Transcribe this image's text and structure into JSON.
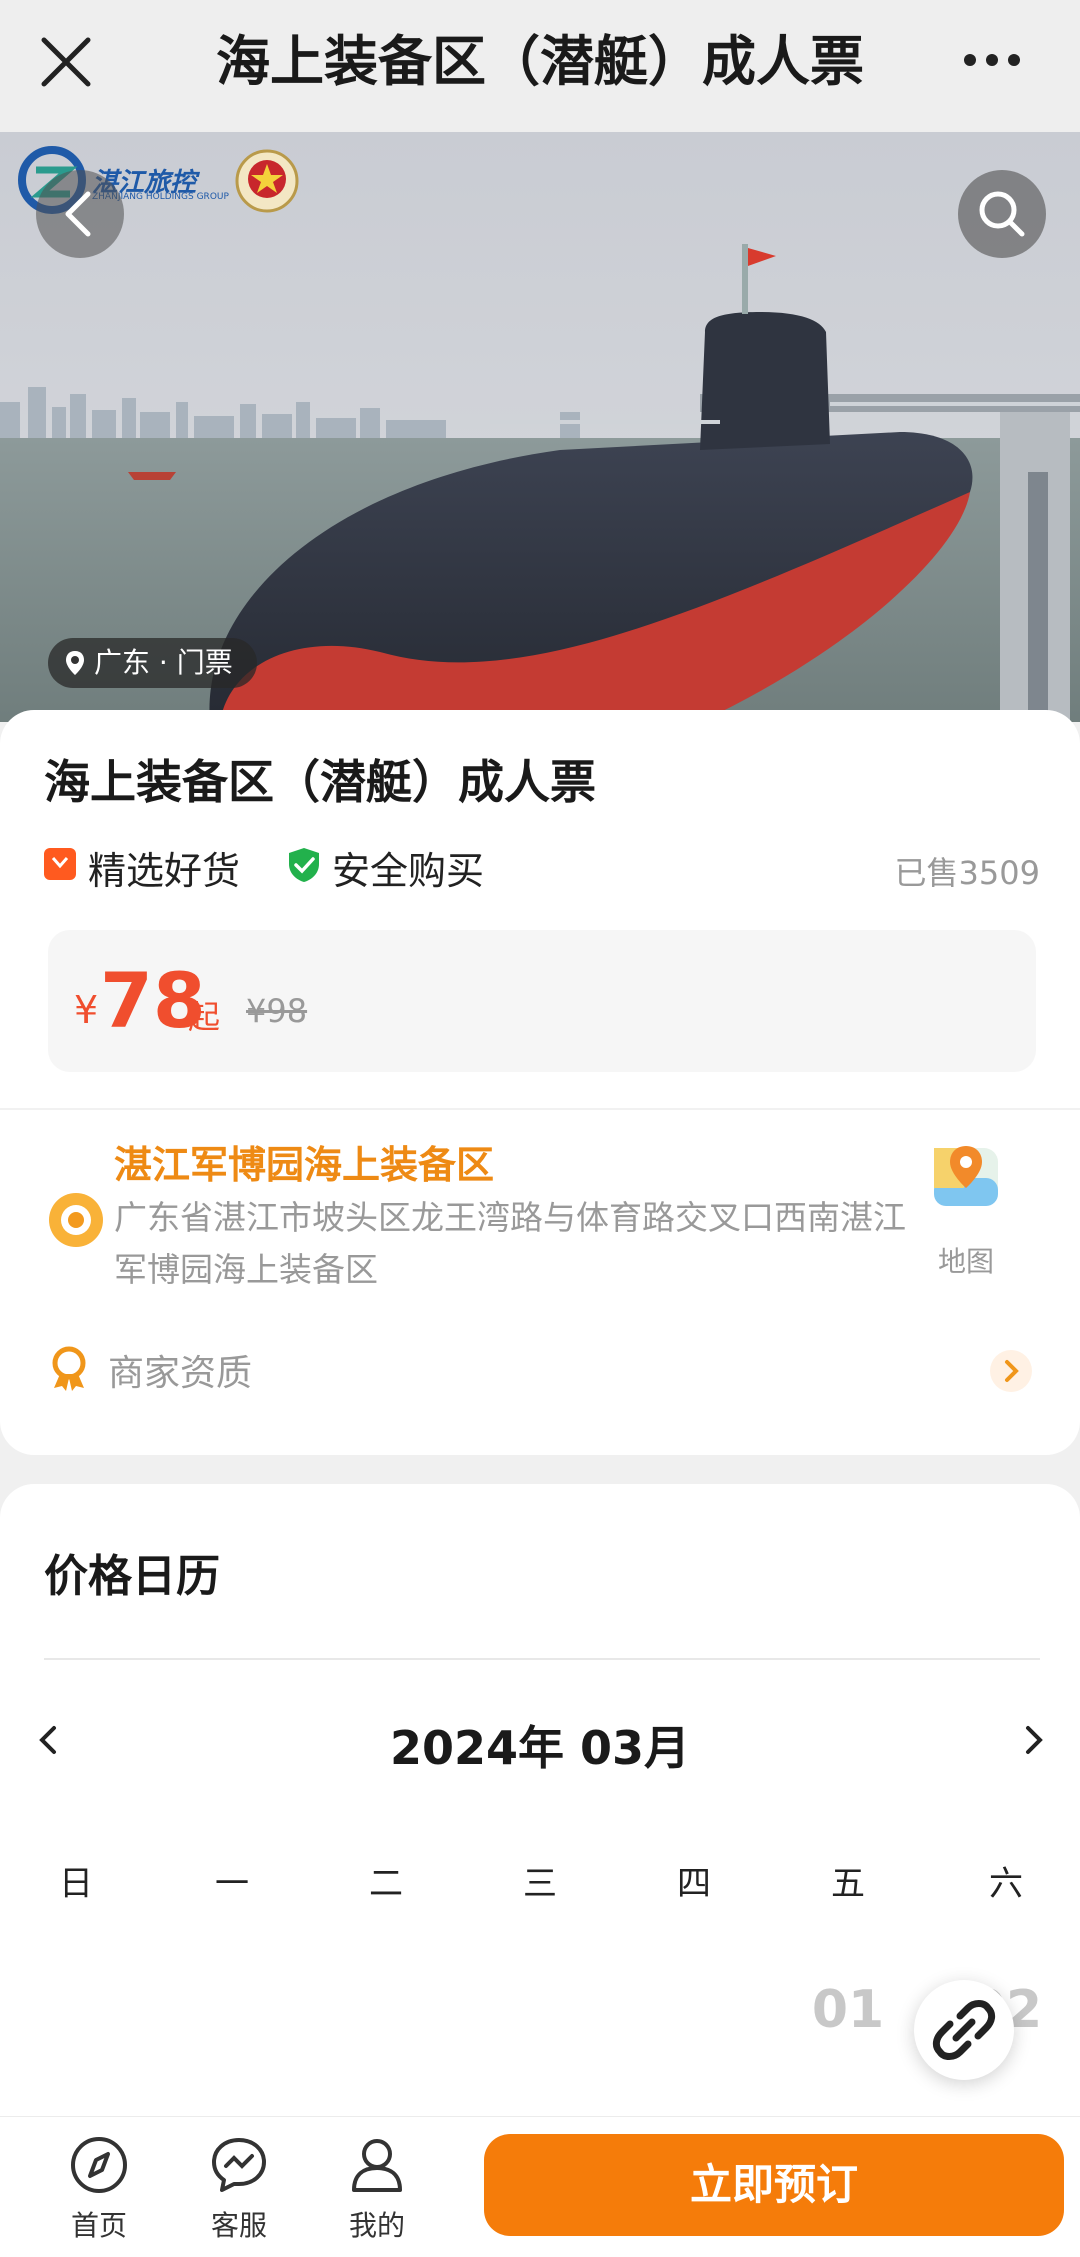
{
  "nav": {
    "title": "海上装备区（潜艇）成人票"
  },
  "hero": {
    "logo_text": "湛江旅控",
    "logo_sub": "ZHANJIANG HOLDINGS GROUP",
    "location_tag": "广东 · 门票"
  },
  "product": {
    "title": "海上装备区（潜艇）成人票",
    "tag1": "精选好货",
    "tag2": "安全购买",
    "sold": "已售3509",
    "price_symbol": "¥",
    "price": "78",
    "price_suffix": "起",
    "original_price": "¥98"
  },
  "venue": {
    "name": "湛江军博园海上装备区",
    "address": "广东省湛江市坡头区龙王湾路与体育路交叉口西南湛江军博园海上装备区",
    "map_label": "地图",
    "qualification": "商家资质"
  },
  "calendar": {
    "title": "价格日历",
    "month": "2024年 03月",
    "weekdays": [
      "日",
      "一",
      "二",
      "三",
      "四",
      "五",
      "六"
    ],
    "visible_days": [
      "01",
      "02"
    ]
  },
  "bottom": {
    "home": "首页",
    "service": "客服",
    "mine": "我的",
    "book": "立即预订"
  },
  "colors": {
    "accent_orange": "#f57c0a",
    "price_red": "#f04e2e",
    "venue_orange": "#ee8a14"
  }
}
